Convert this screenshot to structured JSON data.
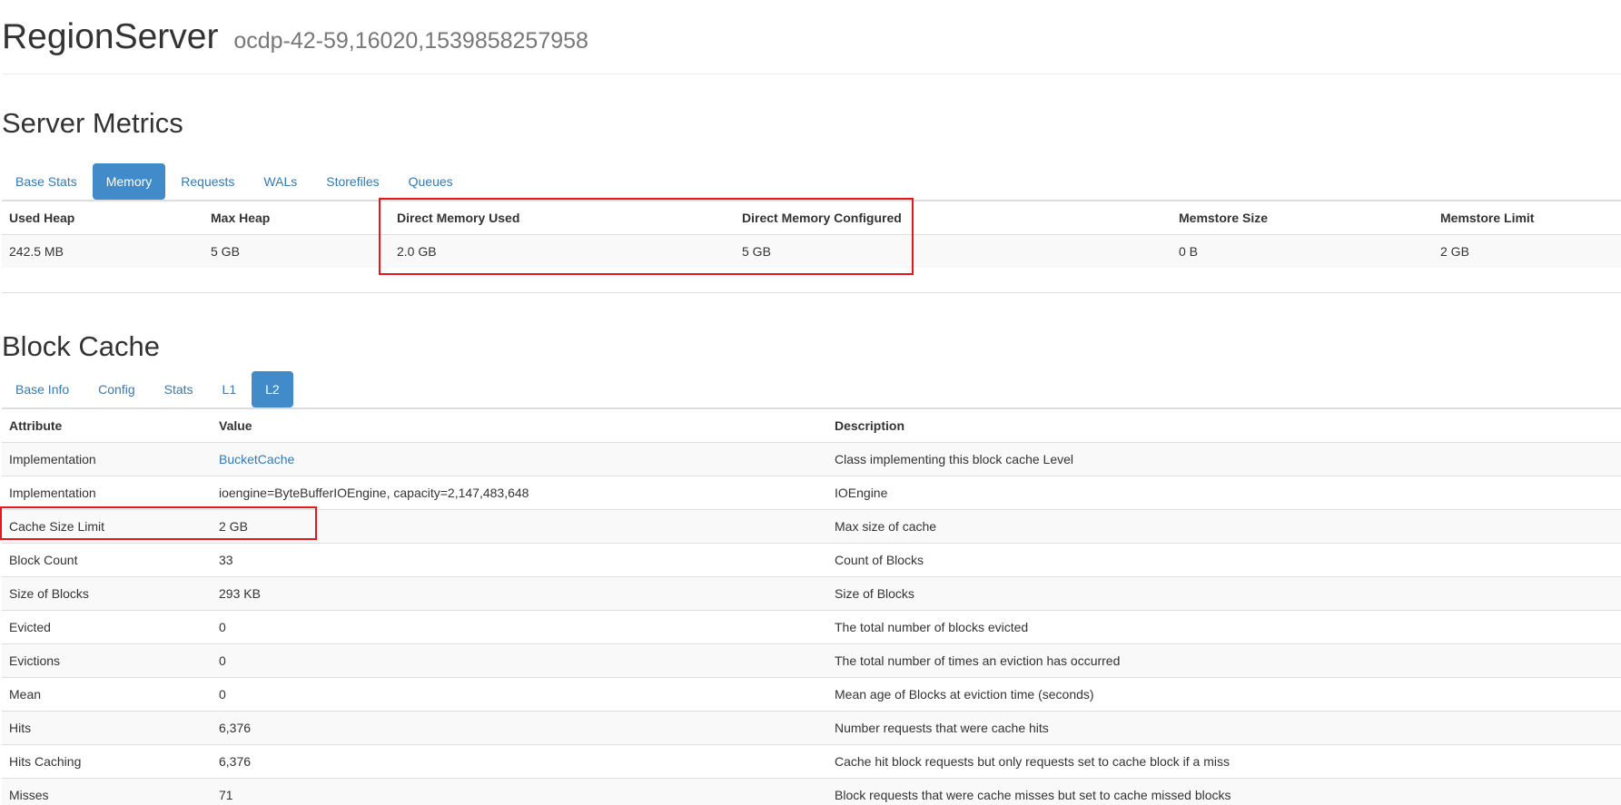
{
  "header": {
    "title": "RegionServer",
    "server_id": "ocdp-42-59,16020,1539858257958"
  },
  "server_metrics": {
    "title": "Server Metrics",
    "tabs": [
      {
        "label": "Base Stats",
        "active": false
      },
      {
        "label": "Memory",
        "active": true
      },
      {
        "label": "Requests",
        "active": false
      },
      {
        "label": "WALs",
        "active": false
      },
      {
        "label": "Storefiles",
        "active": false
      },
      {
        "label": "Queues",
        "active": false
      }
    ],
    "columns": [
      "Used Heap",
      "Max Heap",
      "Direct Memory Used",
      "Direct Memory Configured",
      "Memstore Size",
      "Memstore Limit"
    ],
    "values": [
      "242.5 MB",
      "5 GB",
      "2.0 GB",
      "5 GB",
      "0 B",
      "2 GB"
    ]
  },
  "block_cache": {
    "title": "Block Cache",
    "tabs": [
      {
        "label": "Base Info",
        "active": false
      },
      {
        "label": "Config",
        "active": false
      },
      {
        "label": "Stats",
        "active": false
      },
      {
        "label": "L1",
        "active": false
      },
      {
        "label": "L2",
        "active": true
      }
    ],
    "columns": [
      "Attribute",
      "Value",
      "Description"
    ],
    "rows": [
      {
        "attribute": "Implementation",
        "value": "BucketCache",
        "description": "Class implementing this block cache Level"
      },
      {
        "attribute": "Implementation",
        "value": "ioengine=ByteBufferIOEngine, capacity=2,147,483,648",
        "description": "IOEngine"
      },
      {
        "attribute": "Cache Size Limit",
        "value": "2 GB",
        "description": "Max size of cache"
      },
      {
        "attribute": "Block Count",
        "value": "33",
        "description": "Count of Blocks"
      },
      {
        "attribute": "Size of Blocks",
        "value": "293 KB",
        "description": "Size of Blocks"
      },
      {
        "attribute": "Evicted",
        "value": "0",
        "description": "The total number of blocks evicted"
      },
      {
        "attribute": "Evictions",
        "value": "0",
        "description": "The total number of times an eviction has occurred"
      },
      {
        "attribute": "Mean",
        "value": "0",
        "description": "Mean age of Blocks at eviction time (seconds)"
      },
      {
        "attribute": "Hits",
        "value": "6,376",
        "description": "Number requests that were cache hits"
      },
      {
        "attribute": "Hits Caching",
        "value": "6,376",
        "description": "Cache hit block requests but only requests set to cache block if a miss"
      },
      {
        "attribute": "Misses",
        "value": "71",
        "description": "Block requests that were cache misses but set to cache missed blocks"
      }
    ]
  },
  "colors": {
    "link": "#337ab7",
    "active_tab": "#428bca",
    "highlight_box": "#e8151b"
  }
}
